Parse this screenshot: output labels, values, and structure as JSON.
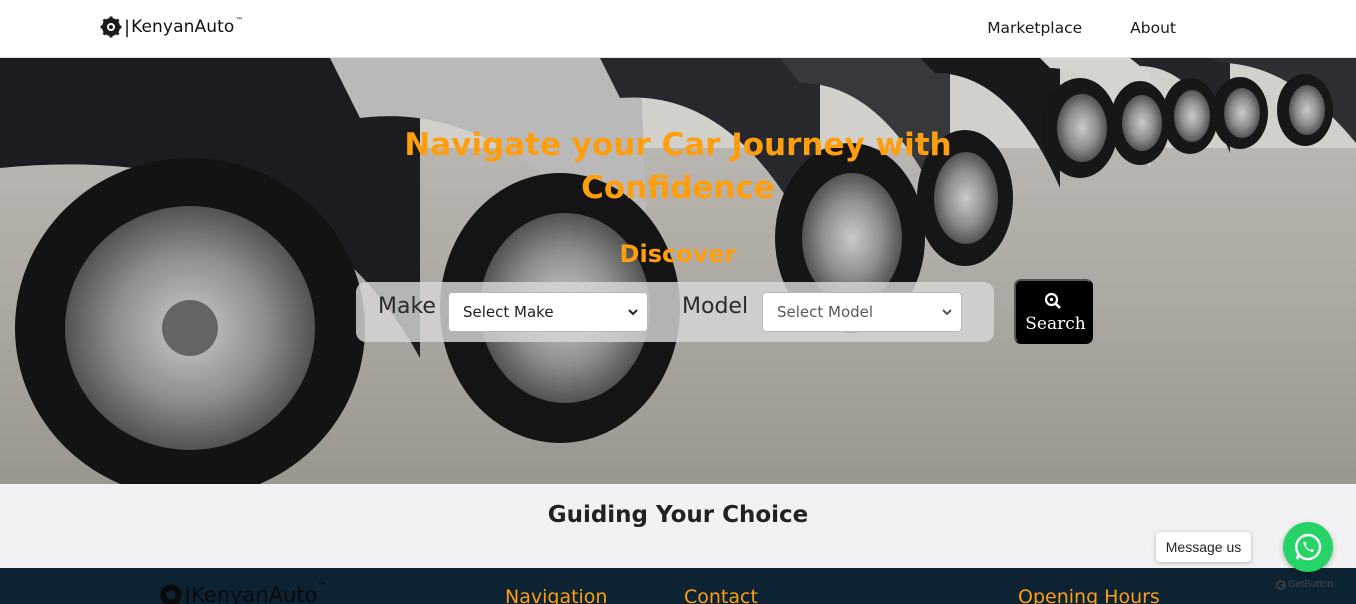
{
  "navbar": {
    "brand_name": "KenyanAuto",
    "brand_tm": "™",
    "links": [
      {
        "label": "Marketplace"
      },
      {
        "label": "About"
      }
    ]
  },
  "hero": {
    "title": "Navigate your Car Journey with Confidence",
    "discover": "Discover",
    "make_label": "Make",
    "make_select_value": "Select Make",
    "model_label": "Model",
    "model_select_value": "Select Model",
    "search_label": "Search"
  },
  "guide": {
    "title": "Guiding Your Choice"
  },
  "footer": {
    "brand_name": "KenyanAuto",
    "brand_tm": "™",
    "headings": {
      "navigation": "Navigation",
      "contact": "Contact",
      "opening_hours": "Opening Hours"
    }
  },
  "widget": {
    "message_label": "Message us",
    "powered_by": "GetButton"
  },
  "colors": {
    "accent": "#ff9f0f",
    "footer_bg": "#0d2233",
    "whatsapp": "#25d366",
    "search_button": "#000000"
  },
  "icons": {
    "brand": "gear-car-logo-icon",
    "search": "magnifier-icon",
    "select_caret": "chevron-down-icon",
    "whatsapp": "whatsapp-icon"
  }
}
